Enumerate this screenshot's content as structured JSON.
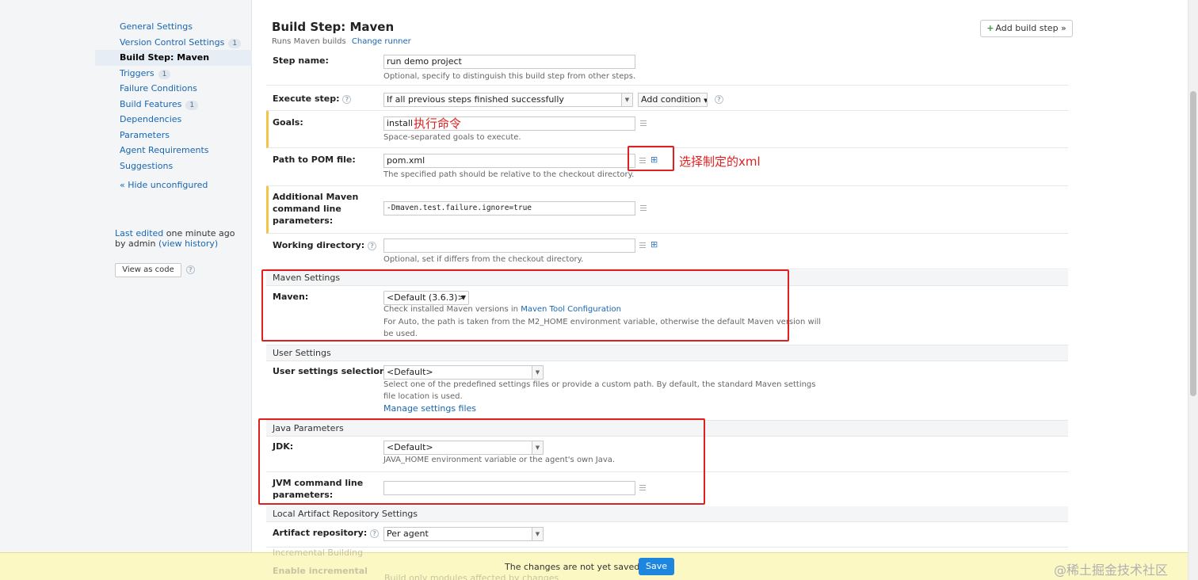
{
  "sidebar": {
    "items": [
      {
        "label": "General Settings",
        "badge": null
      },
      {
        "label": "Version Control Settings",
        "badge": "1"
      },
      {
        "label": "Build Step: Maven",
        "badge": null,
        "active": true
      },
      {
        "label": "Triggers",
        "badge": "1"
      },
      {
        "label": "Failure Conditions",
        "badge": null
      },
      {
        "label": "Build Features",
        "badge": "1"
      },
      {
        "label": "Dependencies",
        "badge": null
      },
      {
        "label": "Parameters",
        "badge": null
      },
      {
        "label": "Agent Requirements",
        "badge": null
      },
      {
        "label": "Suggestions",
        "badge": null
      }
    ],
    "hide_unconfigured": "« Hide unconfigured",
    "last_edited_link": "Last edited",
    "last_edited_time": "one minute ago",
    "by_admin": "by admin",
    "view_history": "(view history)",
    "view_as_code": "View as code"
  },
  "header": {
    "title": "Build Step: Maven",
    "subtitle": "Runs Maven builds",
    "change_runner": "Change runner",
    "add_build_step": "Add build step »"
  },
  "form": {
    "step_name": {
      "label": "Step name:",
      "value": "run demo project",
      "hint": "Optional, specify to distinguish this build step from other steps."
    },
    "execute_step": {
      "label": "Execute step:",
      "value": "If all previous steps finished successfully",
      "add_condition": "Add condition"
    },
    "goals": {
      "label": "Goals:",
      "value": "install",
      "hint": "Space-separated goals to execute."
    },
    "pom": {
      "label": "Path to POM file:",
      "value": "pom.xml",
      "hint": "The specified path should be relative to the checkout directory."
    },
    "additional": {
      "label_lines": [
        "Additional Maven",
        "command line",
        "parameters:"
      ],
      "value": "-Dmaven.test.failure.ignore=true"
    },
    "working_dir": {
      "label": "Working directory:",
      "value": "",
      "hint": "Optional, set if differs from the checkout directory."
    }
  },
  "maven_settings": {
    "header": "Maven Settings",
    "label": "Maven:",
    "value": "<Default (3.6.3)>",
    "hint_prefix": "Check installed Maven versions in",
    "hint_link": "Maven Tool Configuration",
    "hint_line2": "For Auto, the path is taken from the M2_HOME environment variable, otherwise the default Maven version will",
    "hint_line3": "be used."
  },
  "user_settings": {
    "header": "User Settings",
    "label": "User settings selection:",
    "value": "<Default>",
    "hint_line1": "Select one of the predefined settings files or provide a custom path. By default, the standard Maven settings",
    "hint_line2": "file location is used.",
    "manage_link": "Manage settings files"
  },
  "java_parameters": {
    "header": "Java Parameters",
    "jdk_label": "JDK:",
    "jdk_value": "<Default>",
    "jdk_hint": "JAVA_HOME environment variable or the agent's own Java.",
    "jvm_label_lines": [
      "JVM command line",
      "parameters:"
    ],
    "jvm_value": ""
  },
  "local_repo": {
    "header": "Local Artifact Repository Settings",
    "label": "Artifact repository:",
    "value": "Per agent"
  },
  "incremental": {
    "header": "Incremental Building",
    "label": "Enable incremental",
    "option": "Build only modules affected by changes"
  },
  "annotations": {
    "goals_note": "执行命令",
    "pom_note": "选择制定的xml"
  },
  "savebar": {
    "message": "The changes are not yet saved.",
    "save": "Save",
    "watermark": "@稀土掘金技术社区"
  },
  "colors": {
    "link": "#1866b4",
    "accent_button": "#1f86e0",
    "annotation_red": "#e02020",
    "modified_marker": "#f4c447",
    "savebar_bg": "#fbf8c4"
  }
}
